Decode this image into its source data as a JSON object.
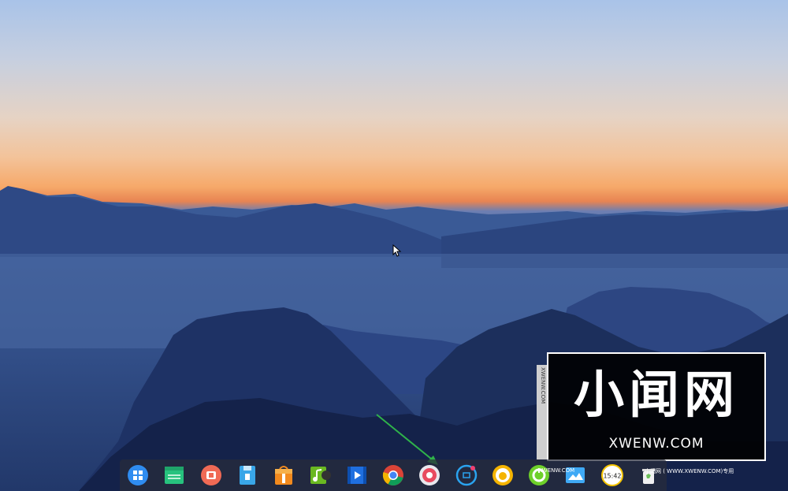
{
  "desktop": {
    "wallpaper": "mountain-sunset",
    "colors": {
      "sky_top": "#a9c3e8",
      "horizon_orange": "#f6a96a",
      "mountain_dark": "#1c2f5c",
      "fog_blue": "#3c5a93"
    }
  },
  "dock": {
    "background": "rgba(40,45,60,0.72)",
    "icons": [
      {
        "name": "launcher-icon",
        "color": "#2f8cf0"
      },
      {
        "name": "file-manager-icon",
        "color": "#27c27e"
      },
      {
        "name": "screen-recorder-icon",
        "color": "#f06a55"
      },
      {
        "name": "package-installer-icon",
        "color": "#39a6e8"
      },
      {
        "name": "app-store-icon",
        "color": "#f28a1e"
      },
      {
        "name": "music-player-icon",
        "color": "#6ab821"
      },
      {
        "name": "video-player-icon",
        "color": "#1f6fe0"
      },
      {
        "name": "chrome-browser-icon",
        "color": "#db4437"
      },
      {
        "name": "system-settings-icon",
        "color": "#e84a5f"
      },
      {
        "name": "screenshot-tool-icon",
        "color": "#2aa3ef"
      },
      {
        "name": "qq-chat-icon",
        "color": "#f5b400"
      },
      {
        "name": "green-app-icon",
        "color": "#6ed02a"
      },
      {
        "name": "image-viewer-icon",
        "color": "#3fa9f5"
      },
      {
        "name": "clock-icon",
        "color": "#ffffff"
      },
      {
        "name": "trash-icon",
        "color": "#9fcf9a"
      }
    ],
    "clock_time": "15:42"
  },
  "watermark": {
    "big_text": "小闻网",
    "url": "XWENW.COM",
    "side_text": "XWENW.COM",
    "small_left": "XWENW.COM",
    "small_right": "小闻网 ( WWW.XWENW.COM)专用"
  },
  "annotation": {
    "arrow_color": "#2fb34a"
  }
}
